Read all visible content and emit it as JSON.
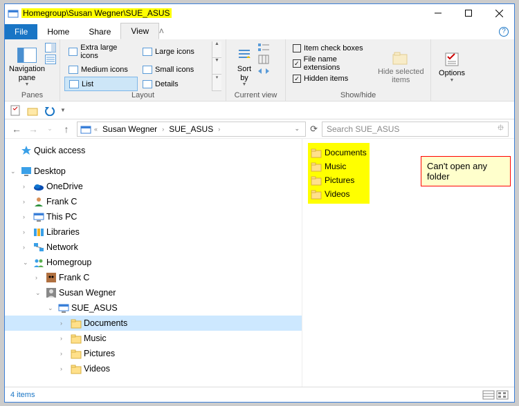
{
  "titlebar": {
    "path": "Homegroup\\Susan Wegner\\SUE_ASUS"
  },
  "tabs": {
    "file": "File",
    "home": "Home",
    "share": "Share",
    "view": "View"
  },
  "ribbon": {
    "panes": {
      "label": "Panes",
      "navigation": "Navigation\npane"
    },
    "layout": {
      "label": "Layout",
      "items": [
        "Extra large icons",
        "Large icons",
        "Medium icons",
        "Small icons",
        "List",
        "Details"
      ]
    },
    "current": {
      "label": "Current view",
      "sort": "Sort\nby"
    },
    "showhide": {
      "label": "Show/hide",
      "checks": [
        "Item check boxes",
        "File name extensions",
        "Hidden items"
      ],
      "hide": "Hide selected\nitems"
    },
    "options": "Options"
  },
  "breadcrumb": {
    "parts": [
      "Susan Wegner",
      "SUE_ASUS"
    ]
  },
  "search": {
    "placeholder": "Search SUE_ASUS"
  },
  "tree": [
    {
      "ind": 0,
      "tw": "",
      "icon": "star",
      "label": "Quick access"
    },
    {
      "spacer": 1
    },
    {
      "ind": 0,
      "tw": "v",
      "icon": "desktop",
      "label": "Desktop"
    },
    {
      "ind": 1,
      "tw": ">",
      "icon": "onedrive",
      "label": "OneDrive"
    },
    {
      "ind": 1,
      "tw": ">",
      "icon": "user",
      "label": "Frank C"
    },
    {
      "ind": 1,
      "tw": ">",
      "icon": "pc",
      "label": "This PC"
    },
    {
      "ind": 1,
      "tw": ">",
      "icon": "libraries",
      "label": "Libraries"
    },
    {
      "ind": 1,
      "tw": ">",
      "icon": "network",
      "label": "Network"
    },
    {
      "ind": 1,
      "tw": "v",
      "icon": "homegroup",
      "label": "Homegroup"
    },
    {
      "ind": 2,
      "tw": ">",
      "icon": "cat",
      "label": "Frank C"
    },
    {
      "ind": 2,
      "tw": "v",
      "icon": "person",
      "label": "Susan Wegner"
    },
    {
      "ind": 3,
      "tw": "v",
      "icon": "pc",
      "label": "SUE_ASUS"
    },
    {
      "ind": 4,
      "tw": ">",
      "icon": "folder",
      "label": "Documents",
      "sel": true
    },
    {
      "ind": 4,
      "tw": ">",
      "icon": "folder",
      "label": "Music"
    },
    {
      "ind": 4,
      "tw": ">",
      "icon": "folder",
      "label": "Pictures"
    },
    {
      "ind": 4,
      "tw": ">",
      "icon": "folder",
      "label": "Videos"
    }
  ],
  "folders": [
    "Documents",
    "Music",
    "Pictures",
    "Videos"
  ],
  "status": {
    "count": "4 items"
  },
  "note": "Can't open any folder"
}
